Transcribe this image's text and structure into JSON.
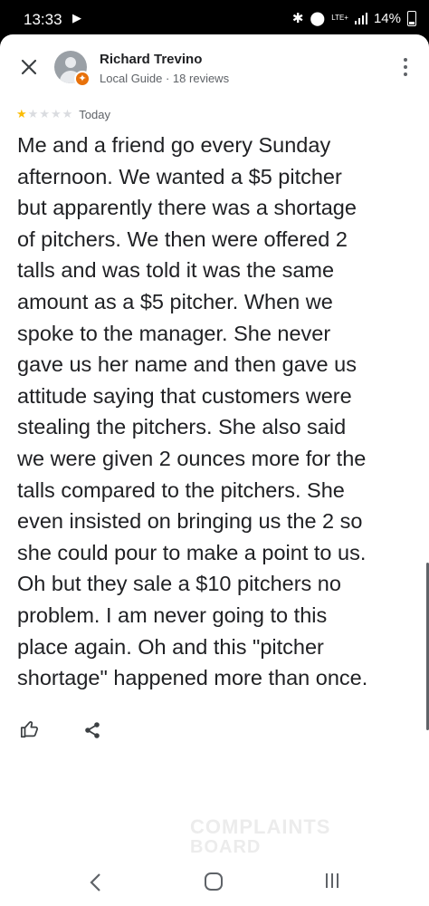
{
  "status_bar": {
    "time": "13:33",
    "network": "LTE+",
    "battery_percent": "14%",
    "battery_level": 0.14
  },
  "reviewer": {
    "name": "Richard Trevino",
    "meta": "Local Guide · 18 reviews",
    "badge_icon": "local-guide-badge"
  },
  "review": {
    "rating": 1,
    "max_rating": 5,
    "date": "Today",
    "lines": [
      "Me and a friend go every Sunday",
      "afternoon. We wanted a $5 pitcher",
      "but apparently there was a shortage",
      "of pitchers. We then were offered 2",
      "talls and was told it was the same",
      "amount as a $5 pitcher. When we",
      "spoke to the manager. She never",
      "gave us her name and then gave us",
      "attitude saying that customers were",
      "stealing the pitchers. She also said",
      "we were given 2 ounces more for the",
      "talls compared to the pitchers. She",
      "even insisted on  bringing us the 2 so",
      "she could pour to make a point to us.",
      "Oh but they sale a $10 pitchers no",
      "problem. I am never going to this",
      "place again. Oh and this \"pitcher",
      "shortage\" happened more than once."
    ]
  },
  "actions": {
    "like_icon": "thumbs-up-icon",
    "share_icon": "share-icon"
  },
  "watermark": {
    "line1": "COMPLAINTS",
    "line2": "BOARD"
  },
  "colors": {
    "star_on": "#fbbc04",
    "star_off": "#dadce0",
    "text": "#202124",
    "secondary": "#5f6368",
    "badge": "#e8710a"
  }
}
